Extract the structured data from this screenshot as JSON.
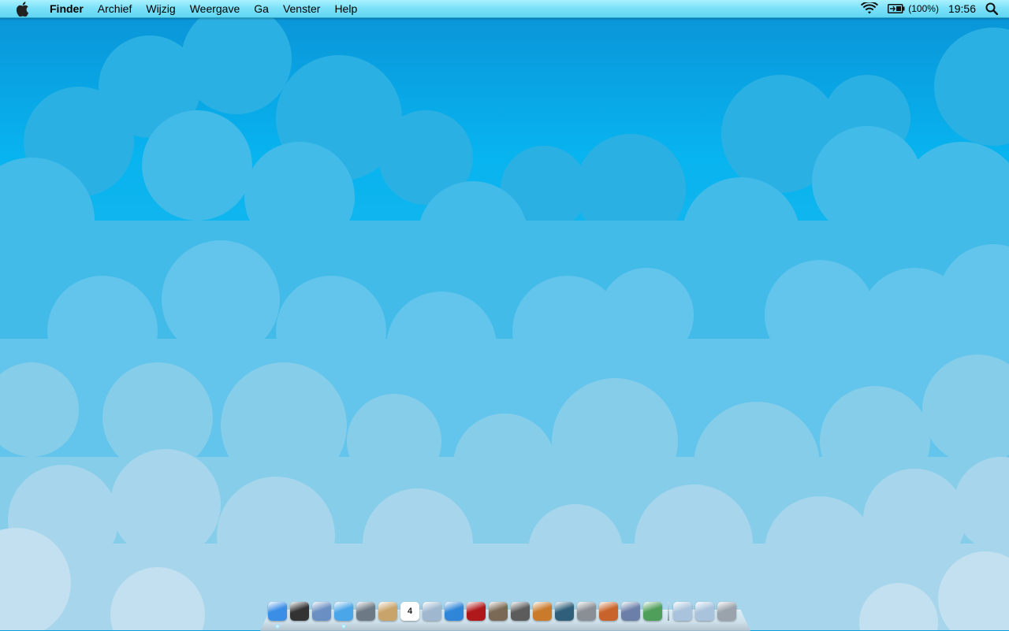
{
  "menubar": {
    "apple_icon": "apple-icon",
    "app_name": "Finder",
    "items": [
      "Archief",
      "Wijzig",
      "Weergave",
      "Ga",
      "Venster",
      "Help"
    ],
    "status": {
      "wifi_icon": "wifi-icon",
      "battery_icon": "battery-charging-icon",
      "battery_text": "(100%)",
      "time": "19:56",
      "spotlight_icon": "spotlight-search-icon"
    }
  },
  "dock": {
    "apps": [
      {
        "name": "finder",
        "icon": "finder-icon",
        "color": "#3b8ee6",
        "running": true
      },
      {
        "name": "dashboard",
        "icon": "dashboard-icon",
        "color": "#333333",
        "running": false
      },
      {
        "name": "mail",
        "icon": "mail-stamp-icon",
        "color": "#6a8fc2",
        "running": false
      },
      {
        "name": "safari",
        "icon": "safari-compass-icon",
        "color": "#4aa6e8",
        "running": true
      },
      {
        "name": "facetime",
        "icon": "facetime-camera-icon",
        "color": "#6d7a85",
        "running": false
      },
      {
        "name": "address-book",
        "icon": "address-book-icon",
        "color": "#c9a46a",
        "running": false
      },
      {
        "name": "ical",
        "icon": "calendar-icon",
        "color": "#ffffff",
        "running": false,
        "label": "4"
      },
      {
        "name": "preview",
        "icon": "preview-photos-icon",
        "color": "#9fb7cf",
        "running": false
      },
      {
        "name": "itunes",
        "icon": "itunes-note-icon",
        "color": "#2f86d8",
        "running": false
      },
      {
        "name": "photo-booth",
        "icon": "photo-booth-icon",
        "color": "#b0191b",
        "running": false
      },
      {
        "name": "iphoto",
        "icon": "iphoto-icon",
        "color": "#7a6a55",
        "running": false
      },
      {
        "name": "imovie",
        "icon": "imovie-star-icon",
        "color": "#5c5c5c",
        "running": false
      },
      {
        "name": "garageband",
        "icon": "garageband-guitar-icon",
        "color": "#c97a2b",
        "running": false
      },
      {
        "name": "time-machine",
        "icon": "time-machine-icon",
        "color": "#2f5f7a",
        "running": false
      },
      {
        "name": "system-preferences",
        "icon": "system-preferences-gear-icon",
        "color": "#8a8f95",
        "running": false
      },
      {
        "name": "keynote",
        "icon": "keynote-podium-icon",
        "color": "#c8642b",
        "running": false
      },
      {
        "name": "pages",
        "icon": "pages-pen-icon",
        "color": "#6b7fa8",
        "running": false
      },
      {
        "name": "numbers",
        "icon": "numbers-chart-icon",
        "color": "#4f9e5a",
        "running": false
      }
    ],
    "stacks": [
      {
        "name": "applications",
        "icon": "applications-folder-icon",
        "color": "#a9c3dc"
      },
      {
        "name": "documents",
        "icon": "documents-folder-icon",
        "color": "#a9c3dc"
      },
      {
        "name": "trash",
        "icon": "trash-icon",
        "color": "#9aa3ab"
      }
    ]
  }
}
